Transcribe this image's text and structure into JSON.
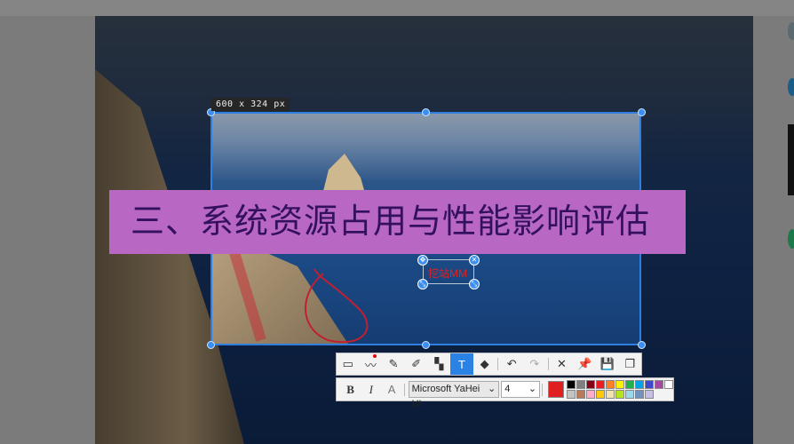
{
  "capture": {
    "size_label": "600 x 324  px"
  },
  "overlay_text": "三、系统资源占用与性能影响评估",
  "annotation_text": "挖站MM",
  "toolbar": {
    "tools": [
      {
        "name": "rectangle-tool-icon",
        "glyph": "▭"
      },
      {
        "name": "polyline-tool-icon",
        "glyph": "〰"
      },
      {
        "name": "pencil-tool-icon",
        "glyph": "✎"
      },
      {
        "name": "marker-tool-icon",
        "glyph": "✐"
      },
      {
        "name": "mosaic-tool-icon",
        "glyph": "▚"
      },
      {
        "name": "text-tool-icon",
        "glyph": "T"
      },
      {
        "name": "eraser-tool-icon",
        "glyph": "◆"
      },
      {
        "name": "undo-icon",
        "glyph": "↶"
      },
      {
        "name": "redo-icon",
        "glyph": "↷"
      },
      {
        "name": "close-icon",
        "glyph": "✕"
      },
      {
        "name": "pin-icon",
        "glyph": "📌"
      },
      {
        "name": "save-icon",
        "glyph": "💾"
      },
      {
        "name": "copy-icon",
        "glyph": "❐"
      }
    ],
    "bold": "B",
    "italic": "I",
    "outline": "A",
    "font": "Microsoft YaHei UI",
    "font_size": "4",
    "chevron": "⌄",
    "current_color": "#e02020",
    "palette": [
      "#000000",
      "#7f7f7f",
      "#880015",
      "#ed1c24",
      "#ff7f27",
      "#fff200",
      "#22b14c",
      "#00a2e8",
      "#3f48cc",
      "#a349a4",
      "#ffffff",
      "#c3c3c3",
      "#b97a57",
      "#ffaec9",
      "#ffc90e",
      "#efe4b0",
      "#b5e61d",
      "#99d9ea",
      "#7092be",
      "#c8bfe7",
      "#d0d0d0"
    ]
  }
}
